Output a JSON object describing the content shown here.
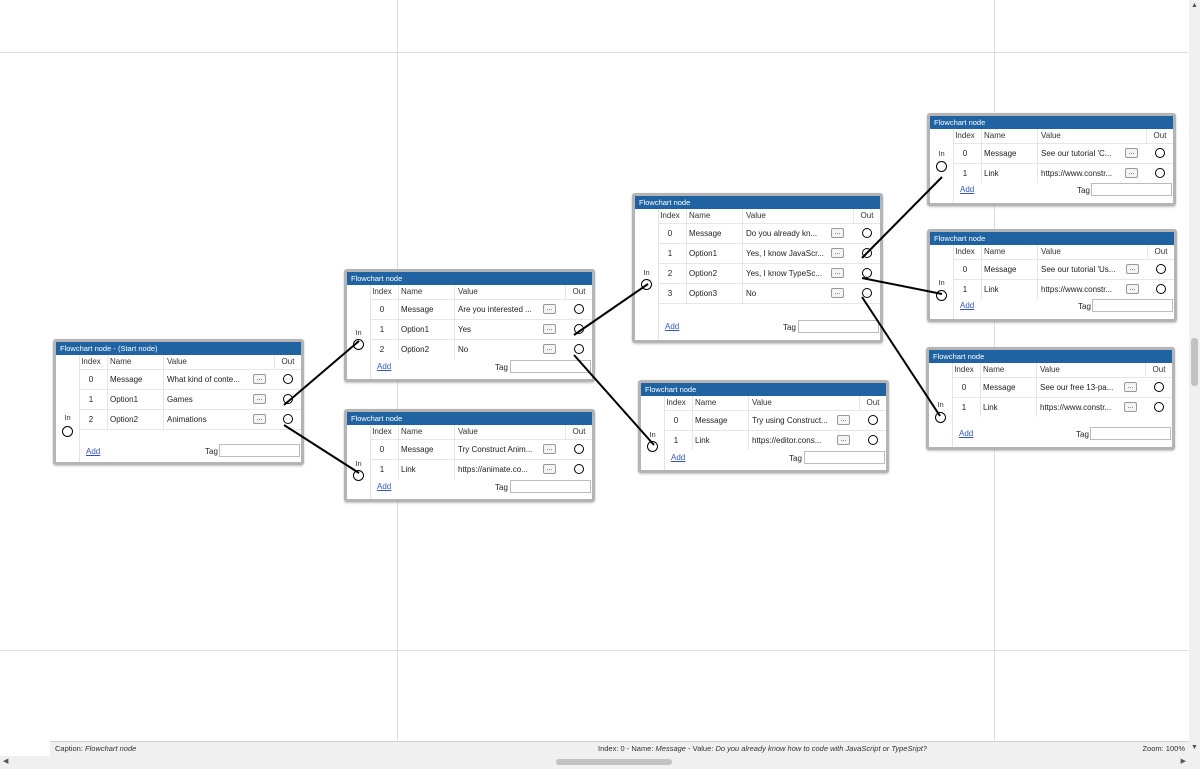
{
  "columns": {
    "index": "Index",
    "name": "Name",
    "value": "Value",
    "out": "Out"
  },
  "in_label": "In",
  "add_label": "Add",
  "tag_label": "Tag",
  "ellipsis": "...",
  "nodes": {
    "start": {
      "title": "Flowchart node - (Start node)",
      "rows": [
        {
          "index": "0",
          "name": "Message",
          "value": "What kind of conte..."
        },
        {
          "index": "1",
          "name": "Option1",
          "value": "Games"
        },
        {
          "index": "2",
          "name": "Option2",
          "value": "Animations"
        }
      ]
    },
    "interest": {
      "title": "Flowchart node",
      "rows": [
        {
          "index": "0",
          "name": "Message",
          "value": "Are you interested ..."
        },
        {
          "index": "1",
          "name": "Option1",
          "value": "Yes"
        },
        {
          "index": "2",
          "name": "Option2",
          "value": "No"
        }
      ]
    },
    "animate": {
      "title": "Flowchart node",
      "rows": [
        {
          "index": "0",
          "name": "Message",
          "value": "Try Construct Anim..."
        },
        {
          "index": "1",
          "name": "Link",
          "value": "https://animate.co..."
        }
      ]
    },
    "knowcode": {
      "title": "Flowchart node",
      "rows": [
        {
          "index": "0",
          "name": "Message",
          "value": "Do you already kn..."
        },
        {
          "index": "1",
          "name": "Option1",
          "value": "Yes, I know JavaScr..."
        },
        {
          "index": "2",
          "name": "Option2",
          "value": "Yes, I know TypeSc..."
        },
        {
          "index": "3",
          "name": "Option3",
          "value": "No"
        }
      ]
    },
    "construct": {
      "title": "Flowchart node",
      "rows": [
        {
          "index": "0",
          "name": "Message",
          "value": "Try using Construct..."
        },
        {
          "index": "1",
          "name": "Link",
          "value": "https://editor.cons..."
        }
      ]
    },
    "tutC": {
      "title": "Flowchart node",
      "rows": [
        {
          "index": "0",
          "name": "Message",
          "value": "See our tutorial 'C..."
        },
        {
          "index": "1",
          "name": "Link",
          "value": "https://www.constr..."
        }
      ]
    },
    "tutUs": {
      "title": "Flowchart node",
      "rows": [
        {
          "index": "0",
          "name": "Message",
          "value": "See our tutorial 'Us..."
        },
        {
          "index": "1",
          "name": "Link",
          "value": "https://www.constr..."
        }
      ]
    },
    "free13": {
      "title": "Flowchart node",
      "rows": [
        {
          "index": "0",
          "name": "Message",
          "value": "See our free 13-pa..."
        },
        {
          "index": "1",
          "name": "Link",
          "value": "https://www.constr..."
        }
      ]
    }
  },
  "statusbar": {
    "caption_label": "Caption: ",
    "caption_value": "Flowchart node",
    "sel_index_label": "Index: 0 - Name: ",
    "sel_name": "Message",
    "sel_value_label": " - Value: ",
    "sel_value": "Do you already know how to code with JavaScript or TypeSript?",
    "zoom": "Zoom: 100%"
  },
  "colors": {
    "header": "#1f63a3",
    "border": "#b4b4b4",
    "link": "#3355cc"
  },
  "icons": {
    "out_port": "circle-outline",
    "in_port": "circle-outline",
    "scroll_left": "triangle-left",
    "scroll_right": "triangle-right",
    "scroll_up": "triangle-up",
    "scroll_down": "triangle-down"
  }
}
